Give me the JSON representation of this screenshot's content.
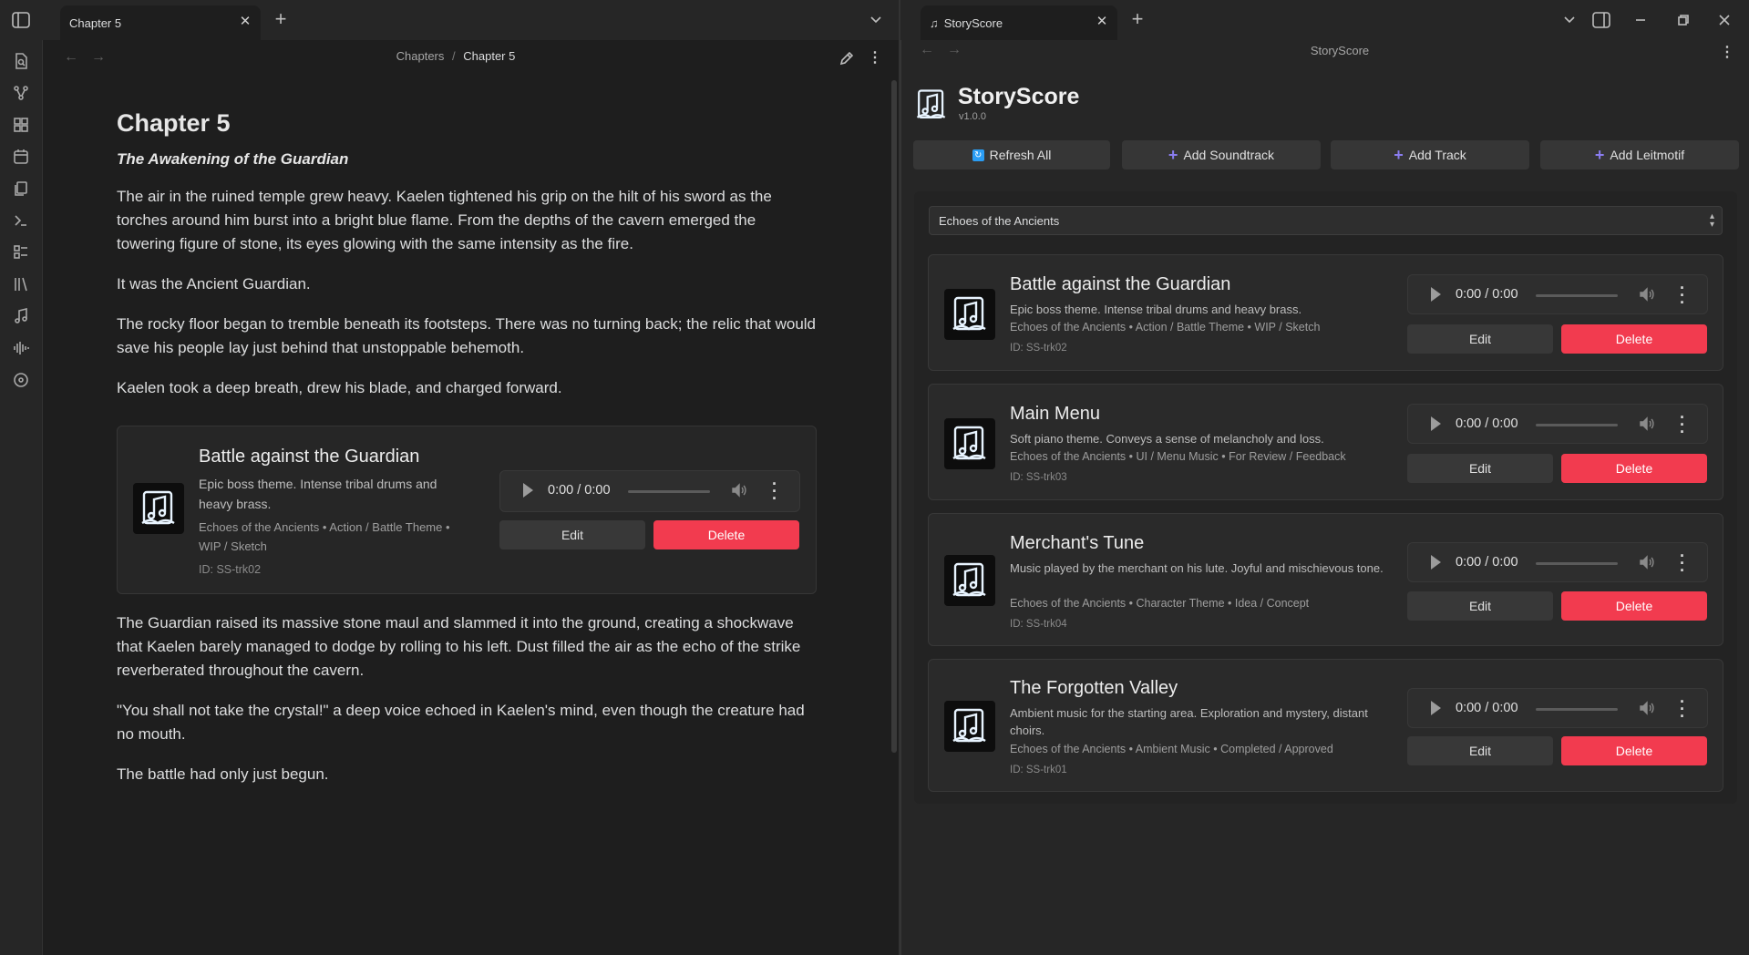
{
  "tabs": {
    "left": {
      "title": "Chapter 5"
    },
    "right": {
      "title": "StoryScore"
    }
  },
  "left_pane": {
    "breadcrumb": {
      "parent": "Chapters",
      "separator": "/",
      "current": "Chapter 5"
    },
    "document": {
      "title": "Chapter 5",
      "subtitle": "The Awakening of the Guardian",
      "paragraphs_before": [
        "The air in the ruined temple grew heavy. Kaelen tightened his grip on the hilt of his sword as the torches around him burst into a bright blue flame. From the depths of the cavern emerged the towering figure of stone, its eyes glowing with the same intensity as the fire.",
        "It was the Ancient Guardian.",
        "The rocky floor began to tremble beneath its footsteps. There was no turning back; the relic that would save his people lay just behind that unstoppable behemoth.",
        "Kaelen took a deep breath, drew his blade, and charged forward."
      ],
      "embed": {
        "title": "Battle against the Guardian",
        "description": "Epic boss theme. Intense tribal drums and heavy brass.",
        "meta": "Echoes of the Ancients • Action / Battle Theme • WIP / Sketch",
        "id": "ID: SS-trk02",
        "time": "0:00 / 0:00",
        "edit_label": "Edit",
        "delete_label": "Delete"
      },
      "paragraphs_after": [
        "The Guardian raised its massive stone maul and slammed it into the ground, creating a shockwave that Kaelen barely managed to dodge by rolling to his left. Dust filled the air as the echo of the strike reverberated throughout the cavern.",
        "\"You shall not take the crystal!\" a deep voice echoed in Kaelen's mind, even though the creature had no mouth.",
        "The battle had only just begun."
      ]
    }
  },
  "right_pane": {
    "header_title": "StoryScore",
    "plugin": {
      "name": "StoryScore",
      "version": "v1.0.0"
    },
    "toolbar": {
      "refresh_label": "Refresh All",
      "add_soundtrack_label": "Add Soundtrack",
      "add_track_label": "Add Track",
      "add_leitmotif_label": "Add Leitmotif"
    },
    "soundtrack_select": {
      "value": "Echoes of the Ancients"
    },
    "tracks": [
      {
        "title": "Battle against the Guardian",
        "description": "Epic boss theme. Intense tribal drums and heavy brass.",
        "meta": "Echoes of the Ancients • Action / Battle Theme • WIP / Sketch",
        "id": "ID: SS-trk02",
        "time": "0:00 / 0:00"
      },
      {
        "title": "Main Menu",
        "description": "Soft piano theme. Conveys a sense of melancholy and loss.",
        "meta": "Echoes of the Ancients • UI / Menu Music • For Review / Feedback",
        "id": "ID: SS-trk03",
        "time": "0:00 / 0:00"
      },
      {
        "title": "Merchant's Tune",
        "description": "Music played by the merchant on his lute. Joyful and mischievous tone.",
        "meta": "Echoes of the Ancients • Character Theme • Idea / Concept",
        "id": "ID: SS-trk04",
        "time": "0:00 / 0:00"
      },
      {
        "title": "The Forgotten Valley",
        "description": "Ambient music for the starting area. Exploration and mystery, distant choirs.",
        "meta": "Echoes of the Ancients • Ambient Music • Completed / Approved",
        "id": "ID: SS-trk01",
        "time": "0:00 / 0:00"
      }
    ],
    "edit_label": "Edit",
    "delete_label": "Delete"
  },
  "colors": {
    "delete": "#f23b4f",
    "accent_plus": "#8a7df0",
    "refresh_icon": "#2a9df4"
  }
}
